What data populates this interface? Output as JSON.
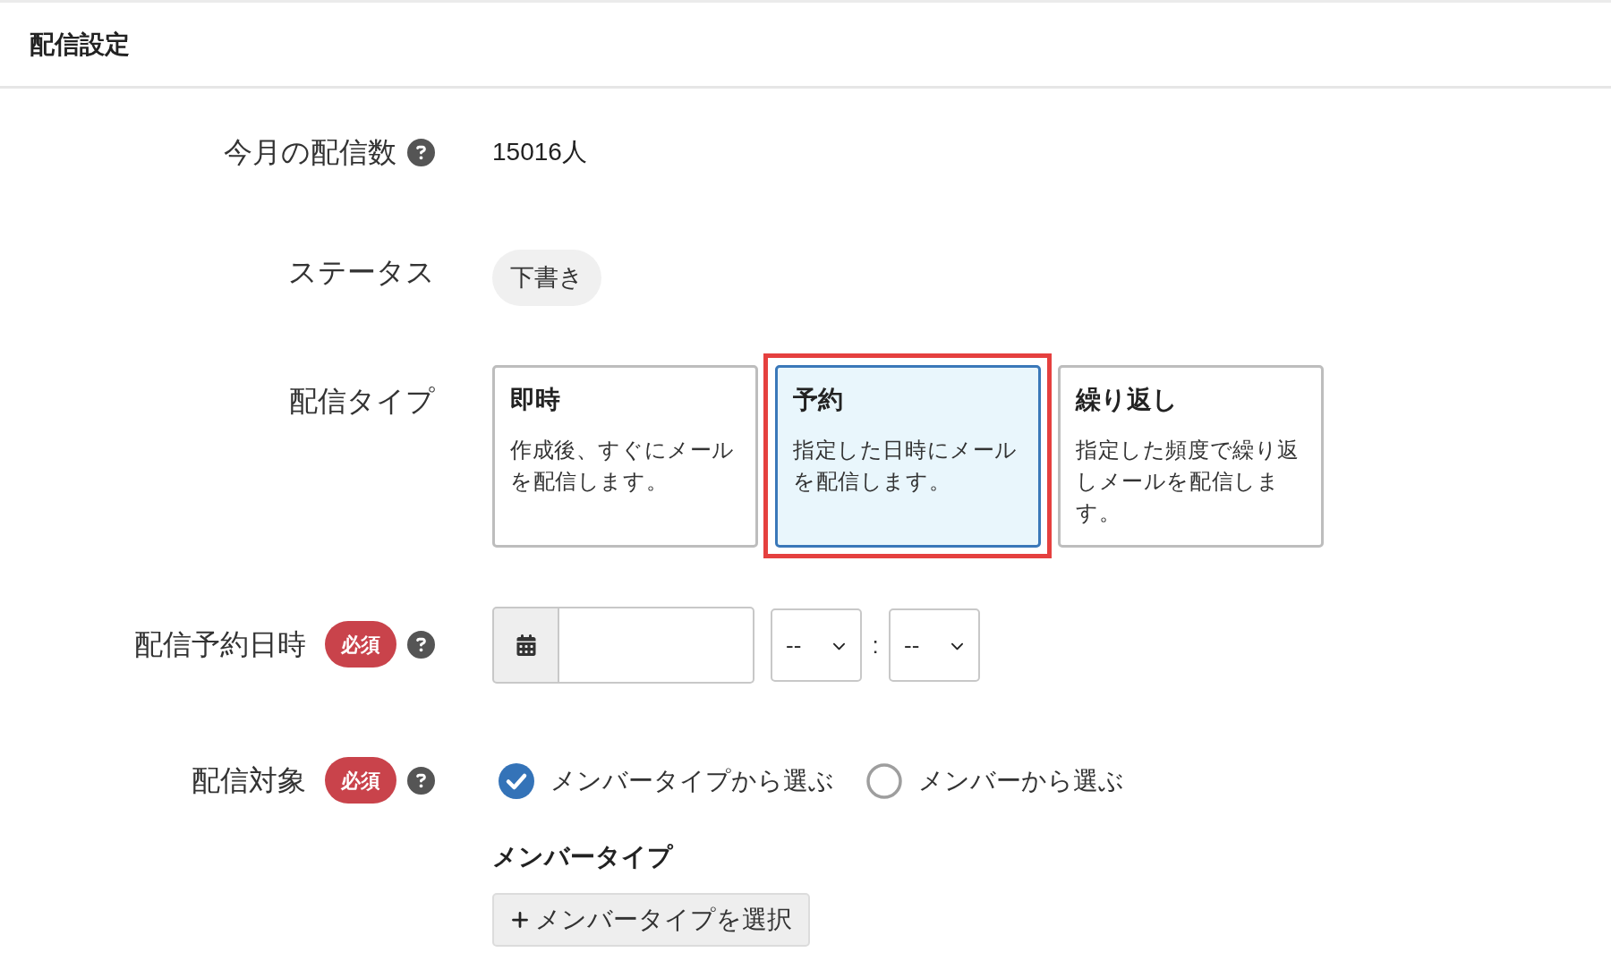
{
  "header": {
    "title": "配信設定"
  },
  "fields": [
    {
      "kind": "count",
      "label": "今月の配信数",
      "help": true,
      "value": "15016人"
    },
    {
      "kind": "status",
      "label": "ステータス",
      "help": false,
      "value": "下書き"
    },
    {
      "kind": "type_cards",
      "label": "配信タイプ",
      "help": false,
      "options": [
        {
          "title": "即時",
          "description": "作成後、すぐにメールを配信します。",
          "selected": false,
          "highlighted": false
        },
        {
          "title": "予約",
          "description": "指定した日時にメールを配信します。",
          "selected": true,
          "highlighted": true
        },
        {
          "title": "繰り返し",
          "description": "指定した頻度で繰り返しメールを配信します。",
          "selected": false,
          "highlighted": false
        }
      ]
    },
    {
      "kind": "datetime",
      "label": "配信予約日時",
      "badge": "必須",
      "help": true,
      "hour": "--",
      "separator": ":",
      "minute": "--"
    },
    {
      "kind": "target",
      "label": "配信対象",
      "badge": "必須",
      "help": true,
      "options": [
        {
          "label": "メンバータイプから選ぶ",
          "selected": true
        },
        {
          "label": "メンバーから選ぶ",
          "selected": false
        }
      ],
      "subheading": "メンバータイプ",
      "button": "メンバータイプを選択"
    }
  ]
}
